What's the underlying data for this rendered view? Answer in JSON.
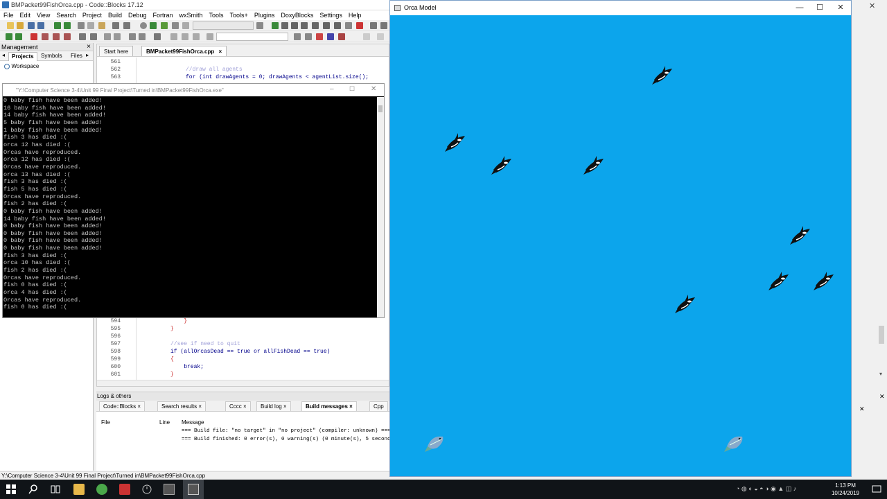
{
  "ide": {
    "title": "BMPacket99FishOrca.cpp - Code::Blocks 17.12",
    "menu": [
      "File",
      "Edit",
      "View",
      "Search",
      "Project",
      "Build",
      "Debug",
      "Fortran",
      "wxSmith",
      "Tools",
      "Tools+",
      "Plugins",
      "DoxyBlocks",
      "Settings",
      "Help"
    ]
  },
  "management": {
    "title": "Management",
    "close": "×",
    "tabs": [
      "Projects",
      "Symbols",
      "Files"
    ],
    "workspace": "Workspace"
  },
  "editor": {
    "tabs": [
      {
        "label": "Start here"
      },
      {
        "label": "BMPacket99FishOrca.cpp",
        "close": "×"
      }
    ],
    "lines_top": [
      {
        "n": "561",
        "code": ""
      },
      {
        "n": "562",
        "code": "//draw all agents"
      },
      {
        "n": "563",
        "code": "for (int drawAgents = 0; drawAgents < agentList.size();"
      }
    ],
    "lines_bottom": [
      {
        "n": "594",
        "code": "    }"
      },
      {
        "n": "595",
        "code": "}"
      },
      {
        "n": "596",
        "code": ""
      },
      {
        "n": "597",
        "code": "//see if need to quit"
      },
      {
        "n": "598",
        "code": "if (allOrcasDead == true or allFishDead == true)"
      },
      {
        "n": "599",
        "code": "{"
      },
      {
        "n": "600",
        "code": "    break;"
      },
      {
        "n": "601",
        "code": "}"
      }
    ]
  },
  "console": {
    "title": "\"Y:\\Computer Science 3-4\\Unit 99 Final Project\\Turned in\\BMPacket99FishOrca.exe\"",
    "lines": [
      "0 baby fish have been added!",
      "16 baby fish have been added!",
      "14 baby fish have been added!",
      "5 baby fish have been added!",
      "1 baby fish have been added!",
      "fish 3 has died :(",
      "orca 12 has died :(",
      "Orcas have reproduced.",
      "orca 12 has died :(",
      "Orcas have reproduced.",
      "orca 13 has died :(",
      "fish 3 has died :(",
      "fish 5 has died :(",
      "Orcas have reproduced.",
      "fish 2 has died :(",
      "0 baby fish have been added!",
      "14 baby fish have been added!",
      "0 baby fish have been added!",
      "0 baby fish have been added!",
      "0 baby fish have been added!",
      "0 baby fish have been added!",
      "fish 3 has died :(",
      "orca 10 has died :(",
      "fish 2 has died :(",
      "Orcas have reproduced.",
      "fish 0 has died :(",
      "orca 4 has died :(",
      "Orcas have reproduced.",
      "fish 0 has died :("
    ]
  },
  "logs": {
    "title": "Logs & others",
    "close": "×",
    "tabs": [
      {
        "label": "Code::Blocks",
        "close": "×"
      },
      {
        "label": "Search results",
        "close": "×"
      },
      {
        "label": "Cccc",
        "close": "×"
      },
      {
        "label": "Build log",
        "close": "×"
      },
      {
        "label": "Build messages",
        "close": "×"
      },
      {
        "label": "Cpp"
      }
    ],
    "columns": [
      "File",
      "Line",
      "Message"
    ],
    "messages": [
      "=== Build file: \"no target\" in \"no project\" (compiler: unknown) ===",
      "=== Build finished: 0 error(s), 0 warning(s) (0 minute(s), 5 second(s)) ==="
    ]
  },
  "status": {
    "path": "Y:\\Computer Science 3-4\\Unit 99 Final Project\\Turned in\\BMPacket99FishOrca.cpp"
  },
  "orca_window": {
    "title": "Orca Model",
    "min": "—",
    "max": "☐",
    "close": "✕",
    "background": "#0ca5ec",
    "orca_count": 8,
    "fish_count": 2
  },
  "taskbar": {
    "time": "1:13 PM",
    "date": "10/24/2019"
  }
}
